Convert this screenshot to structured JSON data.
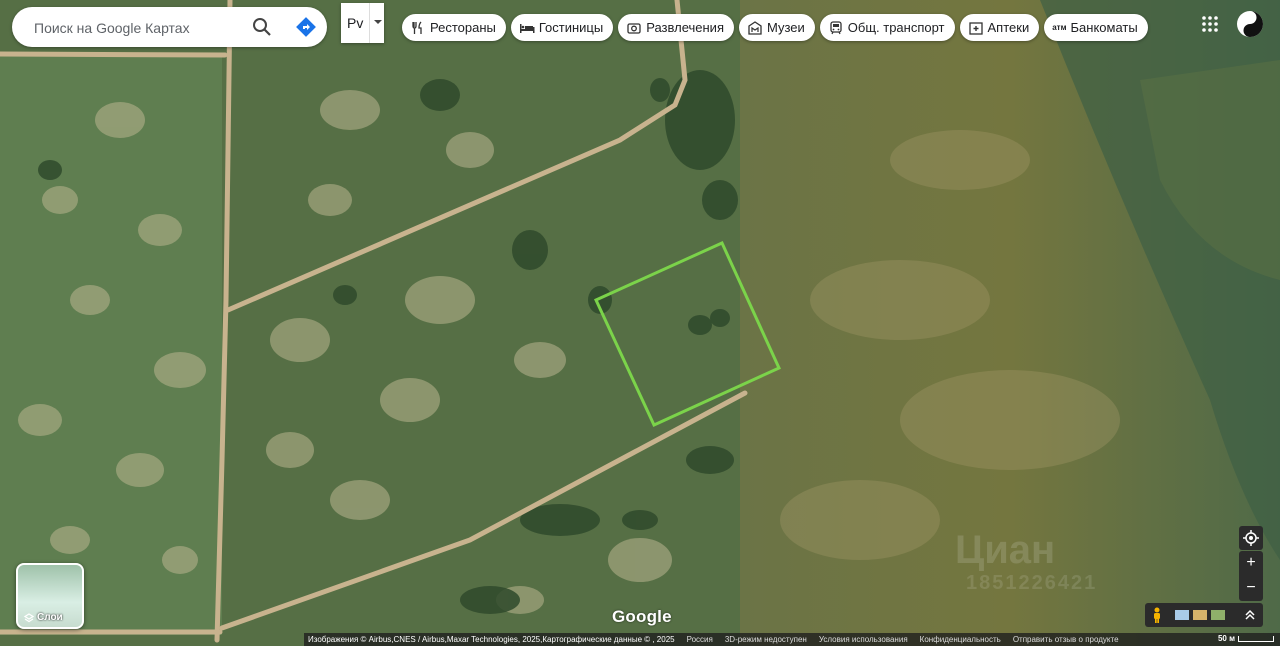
{
  "search": {
    "placeholder": "Поиск на Google Картах"
  },
  "language": {
    "value": "Рv"
  },
  "chips": [
    {
      "label": "Рестораны",
      "icon": "restaurant-icon"
    },
    {
      "label": "Гостиницы",
      "icon": "hotel-icon"
    },
    {
      "label": "Развлечения",
      "icon": "camera-icon"
    },
    {
      "label": "Музеи",
      "icon": "museum-icon"
    },
    {
      "label": "Общ. транспорт",
      "icon": "transit-icon"
    },
    {
      "label": "Аптеки",
      "icon": "pharmacy-icon"
    },
    {
      "label": "Банкоматы",
      "icon": "atm-icon"
    }
  ],
  "atm_icon_text": "атм",
  "layers": {
    "label": "Слои"
  },
  "logo": "Google",
  "watermark": {
    "main": "Циан",
    "id": "1851226421"
  },
  "footer": {
    "attribution": "Изображения © Airbus,CNES / Airbus,Maxar Technologies, 2025,Картографические данные © , 2025",
    "country": "Россия",
    "mode_3d": "3D-режим недоступен",
    "terms": "Условия использования",
    "privacy": "Конфиденциальность",
    "feedback": "Отправить отзыв о продукте",
    "scale": "50 м"
  },
  "colors": {
    "boundary": "#7bd34a",
    "road": "#c8b38e",
    "field_left": "#5e7a4a",
    "field_right": "#6e7242"
  }
}
